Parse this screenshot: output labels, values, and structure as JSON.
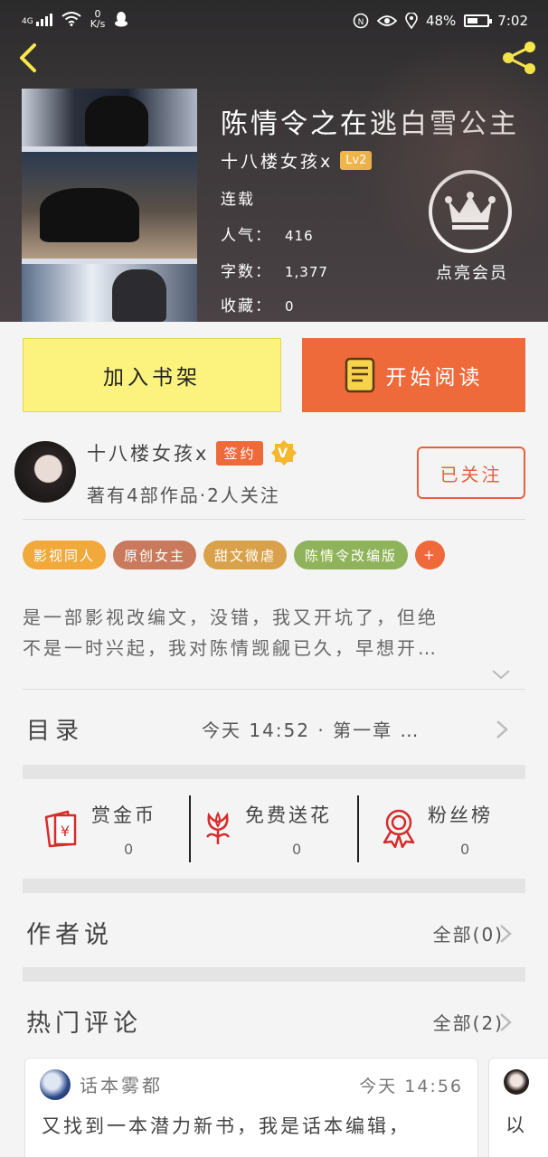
{
  "status_bar": {
    "network_type": "4G",
    "speed_value": "0",
    "speed_unit": "K/s",
    "battery": "48%",
    "time": "7:02"
  },
  "book": {
    "title": "陈情令之在逃白雪公主",
    "author": "十八楼女孩x",
    "level": "Lv2",
    "status": "连载",
    "popularity_label": "人气：",
    "popularity_value": "416",
    "words_label": "字数：",
    "words_value": "1,377",
    "favorites_label": "收藏：",
    "favorites_value": "0",
    "vip_label": "点亮会员"
  },
  "actions": {
    "add_shelf": "加入书架",
    "start_read": "开始阅读"
  },
  "author_panel": {
    "name": "十八楼女孩x",
    "sign_badge": "签约",
    "works": "著有4部作品·2人关注",
    "follow": "已关注"
  },
  "tags": [
    {
      "label": "影视同人",
      "color": "#f0a93a"
    },
    {
      "label": "原创女主",
      "color": "#c97a5c"
    },
    {
      "label": "甜文微虐",
      "color": "#d9a24a"
    },
    {
      "label": "陈情令改编版",
      "color": "#8fb35a"
    },
    {
      "label": "+",
      "color": "#ef6a3b"
    }
  ],
  "description": {
    "line1": "是一部影视改编文，没错，我又开坑了，但绝",
    "line2": "不是一时兴起，我对陈情觊觎已久，早想开…"
  },
  "catalog": {
    "label": "目录",
    "latest": "今天 14:52 · 第一章 …"
  },
  "rewards": [
    {
      "label": "赏金币",
      "count": "0"
    },
    {
      "label": "免费送花",
      "count": "0"
    },
    {
      "label": "粉丝榜",
      "count": "0"
    }
  ],
  "author_says": {
    "label": "作者说",
    "all": "全部(0)"
  },
  "hot_comments": {
    "label": "热门评论",
    "all": "全部(2)",
    "items": [
      {
        "user": "话本雾都",
        "time": "今天 14:56",
        "text": "又找到一本潜力新书，我是话本编辑，"
      },
      {
        "text": "以"
      }
    ]
  },
  "colors": {
    "accent": "#ef6a3b",
    "shelf_button": "#fbf37d"
  }
}
